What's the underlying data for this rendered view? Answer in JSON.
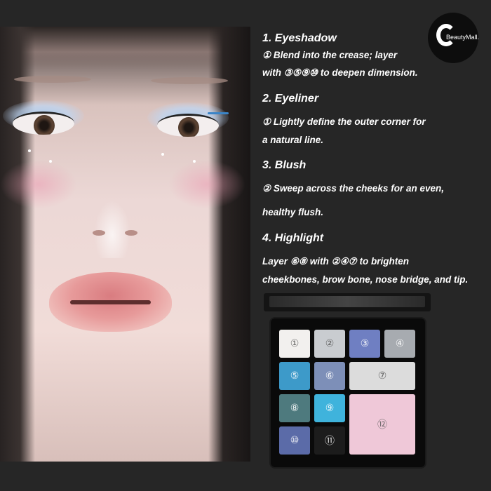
{
  "logo": {
    "text": "BeautyMall."
  },
  "steps": [
    {
      "heading": "1. Eyeshadow",
      "lines": [
        "① Blend into the crease; layer",
        "with ③⑤⑨⑩ to deepen dimension."
      ]
    },
    {
      "heading": "2. Eyeliner",
      "lines": [
        "① Lightly define the outer corner for",
        "a natural line."
      ]
    },
    {
      "heading": "3. Blush",
      "lines": [
        "② Sweep across the cheeks for an even,",
        "healthy flush."
      ]
    },
    {
      "heading": "4. Highlight",
      "lines": [
        "Layer ⑥⑧ with ②④⑦ to brighten",
        "cheekbones, brow bone, nose bridge, and tip."
      ]
    }
  ],
  "palette": {
    "pans": [
      {
        "label": "①",
        "color": "#f2f0ee"
      },
      {
        "label": "②",
        "color": "#c9ccd0"
      },
      {
        "label": "③",
        "color": "#6f7fc2"
      },
      {
        "label": "④",
        "color": "#a7abb0"
      },
      {
        "label": "⑤",
        "color": "#3d9ac9"
      },
      {
        "label": "⑥",
        "color": "#7d8fb8"
      },
      {
        "label": "⑦",
        "color": "#dcdcdc"
      },
      {
        "label": "⑧",
        "color": "#4e7a7e"
      },
      {
        "label": "⑨",
        "color": "#3fb3dc"
      },
      {
        "label": "⑩",
        "color": "#5b6ba8"
      },
      {
        "label": "⑪",
        "color": "#1c1c1c"
      },
      {
        "label": "⑫",
        "color": "#efc8d8"
      }
    ]
  }
}
